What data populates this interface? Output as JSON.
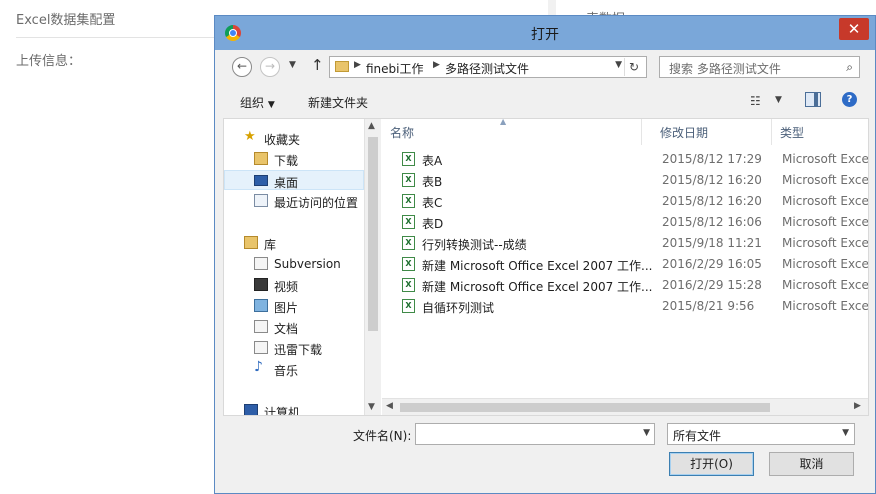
{
  "background": {
    "panel_title": "Excel数据集配置",
    "upload_label": "上传信息：",
    "right_title": "表数据"
  },
  "dialog": {
    "title": "打开",
    "close_symbol": "✕",
    "address": {
      "crumbs": [
        "finebi工作",
        "多路径测试文件"
      ]
    },
    "search_placeholder": "搜索 多路径测试文件",
    "toolbar": {
      "organize": "组织",
      "new_folder": "新建文件夹"
    },
    "nav": [
      {
        "label": "收藏夹",
        "icon": "star-icon"
      },
      {
        "label": "下载",
        "icon": "download-folder-icon"
      },
      {
        "label": "桌面",
        "icon": "desktop-icon",
        "selected": true
      },
      {
        "label": "最近访问的位置",
        "icon": "recent-places-icon"
      },
      {
        "label": "库",
        "icon": "library-icon"
      },
      {
        "label": "Subversion",
        "icon": "document-icon"
      },
      {
        "label": "视频",
        "icon": "video-icon"
      },
      {
        "label": "图片",
        "icon": "picture-icon"
      },
      {
        "label": "文档",
        "icon": "document-icon"
      },
      {
        "label": "迅雷下载",
        "icon": "document-icon"
      },
      {
        "label": "音乐",
        "icon": "music-icon"
      },
      {
        "label": "计算机",
        "icon": "computer-icon"
      }
    ],
    "columns": {
      "name": "名称",
      "date": "修改日期",
      "type": "类型"
    },
    "files": [
      {
        "name": "表A",
        "date": "2015/8/12 17:29",
        "type": "Microsoft Excel"
      },
      {
        "name": "表B",
        "date": "2015/8/12 16:20",
        "type": "Microsoft Excel"
      },
      {
        "name": "表C",
        "date": "2015/8/12 16:20",
        "type": "Microsoft Excel"
      },
      {
        "name": "表D",
        "date": "2015/8/12 16:06",
        "type": "Microsoft Excel"
      },
      {
        "name": "行列转换测试--成绩",
        "date": "2015/9/18 11:21",
        "type": "Microsoft Excel"
      },
      {
        "name": "新建 Microsoft Office Excel 2007 工作...",
        "date": "2016/2/29 16:05",
        "type": "Microsoft Excel"
      },
      {
        "name": "新建 Microsoft Office Excel 2007 工作...",
        "date": "2016/2/29 15:28",
        "type": "Microsoft Excel"
      },
      {
        "name": "自循环列测试",
        "date": "2015/8/21 9:56",
        "type": "Microsoft Excel"
      }
    ],
    "filename_label": "文件名(N):",
    "filename_value": "",
    "filetype_selected": "所有文件",
    "open_button": "打开(O)",
    "cancel_button": "取消"
  }
}
